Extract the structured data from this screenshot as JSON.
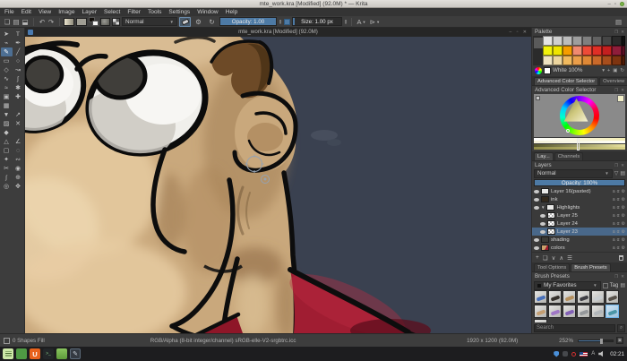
{
  "window": {
    "title": "mte_work.kra [Modified] (92.0M) * — Krita",
    "controls": [
      "minimize",
      "maximize",
      "close"
    ]
  },
  "menu": {
    "items": [
      "File",
      "Edit",
      "View",
      "Image",
      "Layer",
      "Select",
      "Filter",
      "Tools",
      "Settings",
      "Window",
      "Help"
    ]
  },
  "toolbar": {
    "file_icons": [
      {
        "glyph": "❏",
        "name": "new-document-icon"
      },
      {
        "glyph": "▤",
        "name": "open-document-icon"
      },
      {
        "glyph": "⬓",
        "name": "save-document-icon"
      }
    ],
    "edit_icons": [
      {
        "glyph": "↶",
        "name": "undo-icon"
      },
      {
        "glyph": "↷",
        "name": "redo-icon"
      }
    ],
    "blend_label": "Normal",
    "opacity_label": "Opacity: 1.00",
    "size_label": "Size: 1.00 px",
    "mirror_label": "A",
    "flip_glyph": "⊳",
    "workspace_glyph": "▤",
    "accent_color": "#4d7aa5"
  },
  "subwindow": {
    "title": "mte_work.kra [Modified] (92.0M)"
  },
  "toolbox": {
    "tools": [
      {
        "g": "➤",
        "n": "select-shapes-tool"
      },
      {
        "g": "T",
        "n": "text-tool"
      },
      {
        "g": "⌁",
        "n": "edit-shapes-tool"
      },
      {
        "g": "✒",
        "n": "calligraphy-tool"
      },
      {
        "g": "✎",
        "n": "freehand-brush-tool",
        "active": true
      },
      {
        "g": "╱",
        "n": "line-tool"
      },
      {
        "g": "▭",
        "n": "rectangle-tool"
      },
      {
        "g": "○",
        "n": "ellipse-tool"
      },
      {
        "g": "◇",
        "n": "polygon-tool"
      },
      {
        "g": "↝",
        "n": "polyline-tool"
      },
      {
        "g": "∿",
        "n": "bezier-curve-tool"
      },
      {
        "g": "∫",
        "n": "freehand-path-tool"
      },
      {
        "g": "≈",
        "n": "dynamic-brush-tool"
      },
      {
        "g": "✱",
        "n": "multibrush-tool"
      },
      {
        "g": "▣",
        "n": "transform-tool"
      },
      {
        "g": "✚",
        "n": "move-tool"
      },
      {
        "g": "▦",
        "n": "crop-tool"
      },
      {
        "g": "",
        "n": "toolbox-spacer-1"
      },
      {
        "g": "▼",
        "n": "gradient-tool"
      },
      {
        "g": "↗",
        "n": "color-sampler-tool"
      },
      {
        "g": "▨",
        "n": "pattern-tool"
      },
      {
        "g": "✕",
        "n": "reference-images-tool"
      },
      {
        "g": "◆",
        "n": "fill-tool"
      },
      {
        "g": "",
        "n": "toolbox-spacer-2"
      },
      {
        "g": "△",
        "n": "assistants-tool"
      },
      {
        "g": "∠",
        "n": "measure-tool"
      },
      {
        "g": "▢",
        "n": "rectangular-select-tool"
      },
      {
        "g": "◌",
        "n": "elliptical-select-tool"
      },
      {
        "g": "✦",
        "n": "polygonal-select-tool"
      },
      {
        "g": "∾",
        "n": "freehand-select-tool"
      },
      {
        "g": "✂",
        "n": "contiguous-select-tool"
      },
      {
        "g": "◉",
        "n": "similar-color-select-tool"
      },
      {
        "g": "ʃ",
        "n": "bezier-select-tool"
      },
      {
        "g": "⊕",
        "n": "magnetic-select-tool"
      },
      {
        "g": "◎",
        "n": "zoom-tool"
      },
      {
        "g": "✥",
        "n": "pan-tool"
      }
    ]
  },
  "palette": {
    "title": "Palette",
    "rows": [
      [
        "#e4e4e4",
        "#cfcfcf",
        "#bcbcbc",
        "#9e9e9e",
        "#7f7f7f",
        "#616161",
        "#454545",
        "#2a2a2a",
        "#101010"
      ],
      [
        "#f2f20c",
        "#f0e400",
        "#f59d00",
        "#f08a70",
        "#ee4b38",
        "#e02f26",
        "#c41f1f",
        "#8f1d3a",
        "#5c0f22"
      ],
      [
        "#efe3c0",
        "#ecd59e",
        "#f0b95e",
        "#ea9e4a",
        "#df8836",
        "#c9692a",
        "#a84e1d",
        "#7e3410",
        "#521c06"
      ]
    ],
    "color_label": "White 100%",
    "buttons": [
      {
        "glyph": "▾",
        "name": "palette-options-button"
      },
      {
        "glyph": "+",
        "name": "palette-add-button"
      },
      {
        "glyph": "▣",
        "name": "palette-load-button"
      },
      {
        "glyph": "↻",
        "name": "palette-sync-button"
      }
    ]
  },
  "tab_bars": {
    "color": {
      "tabs": [
        "Advanced Color Selector",
        "Overview"
      ],
      "active": 0
    },
    "layers": {
      "tabs": [
        "Lay...",
        "Channels"
      ],
      "active": 0
    },
    "tools": {
      "tabs": [
        "Tool Options",
        "Brush Presets"
      ],
      "active": 1
    }
  },
  "color_selector": {
    "title": "Advanced Color Selector",
    "current_color": "#f1eec8",
    "strips": [
      {
        "name": "shade-strip-light",
        "gradient": [
          "#ffffff",
          "#f2ecb4"
        ]
      },
      {
        "name": "shade-strip-white",
        "gradient": [
          "#f5f2da",
          "#fdfdf6"
        ]
      },
      {
        "name": "shade-strip-yellow",
        "gradient": [
          "#55552c",
          "#e8e2a0"
        ]
      },
      {
        "name": "shade-strip-olive",
        "gradient": [
          "#918d48",
          "#d9d38a"
        ]
      }
    ]
  },
  "layers": {
    "title": "Layers",
    "blend_label": "Normal",
    "opacity_label": "Opacity: 100%",
    "items": [
      {
        "name": "Layer 16(pasted)",
        "thumb": "white",
        "indent": 0
      },
      {
        "name": "ink",
        "thumb": "dark",
        "indent": 0
      },
      {
        "name": "Highlights",
        "thumb": "white",
        "indent": 0,
        "group": true
      },
      {
        "name": "Layer 25",
        "thumb": "checker",
        "indent": 1
      },
      {
        "name": "Layer 24",
        "thumb": "checker",
        "indent": 1
      },
      {
        "name": "Layer 23",
        "thumb": "checker",
        "indent": 1,
        "selected": true
      },
      {
        "name": "shading",
        "thumb": "shading",
        "indent": 0
      },
      {
        "name": "colors",
        "thumb": "colors",
        "indent": 0
      }
    ],
    "row_icons": [
      "a",
      "α"
    ],
    "buttons": [
      {
        "glyph": "+",
        "name": "add-layer-button"
      },
      {
        "glyph": "❏",
        "name": "duplicate-layer-button"
      },
      {
        "glyph": "∨",
        "name": "move-layer-down-button"
      },
      {
        "glyph": "∧",
        "name": "move-layer-up-button"
      },
      {
        "glyph": "☰",
        "name": "layer-properties-button"
      }
    ]
  },
  "brush_presets": {
    "title": "Brush Presets",
    "tag_dropdown_label": "My Favorites",
    "tag_label": "Tag",
    "search_placeholder": "Search",
    "cells": [
      {
        "name": "preset-ink-pen-blue",
        "stroke": "#3a66b8"
      },
      {
        "name": "preset-charcoal",
        "stroke": "#26211c"
      },
      {
        "name": "preset-pencil-tan",
        "stroke": "#b28a52"
      },
      {
        "name": "preset-ink-nib",
        "stroke": "#2e2e34"
      },
      {
        "name": "preset-airbrush-soft",
        "stroke": "#c8cdd2"
      },
      {
        "name": "preset-bristle-dark",
        "stroke": "#4a443c"
      },
      {
        "name": "preset-smudge-tan",
        "stroke": "#c49a68"
      },
      {
        "name": "preset-airbrush-purple",
        "stroke": "#9a6ec4"
      },
      {
        "name": "preset-marker-violet",
        "stroke": "#7b57b5"
      },
      {
        "name": "preset-texture-gray",
        "stroke": "#8f9296"
      },
      {
        "name": "preset-wet-soft",
        "stroke": "#aeb4b8"
      },
      {
        "name": "preset-wet-teal-selected",
        "stroke": "#3f8fa0",
        "selected": true
      },
      {
        "name": "preset-sketch-gray",
        "stroke": "#a0a4a8"
      }
    ]
  },
  "statusbar": {
    "selection_label": "0 Shapes Fill",
    "colorspace_label": "RGB/Alpha (8-bit integer/channel)  sRGB-elle-V2-srgbtrc.icc",
    "dims_label": "1920 x 1200 (92.0M)",
    "zoom_label": "252%"
  },
  "taskbar": {
    "apps": [
      {
        "name": "notes-app-icon",
        "kind": "notes"
      },
      {
        "name": "green-app-icon",
        "kind": "green"
      },
      {
        "name": "media-app-icon",
        "kind": "media",
        "glyph": "U"
      },
      {
        "name": "terminal-app-icon",
        "kind": "term",
        "glyph": ">_"
      },
      {
        "name": "file-manager-icon",
        "kind": "files"
      },
      {
        "name": "krita-app-icon",
        "kind": "krita",
        "glyph": "✎",
        "active": true
      }
    ],
    "clock": "02:21"
  },
  "canvas_colors": {
    "background": "#3a4150",
    "skin": "#c9a87c",
    "skin_light": "#e8cda4",
    "skin_shadow": "#9a7650",
    "outline": "#0d0d0d",
    "eye_white": "#f0efeb",
    "pupil": "#403e3a",
    "hair": "#6d4a27",
    "shirt": "#a01d32",
    "shirt_dark": "#5c0d1c"
  }
}
